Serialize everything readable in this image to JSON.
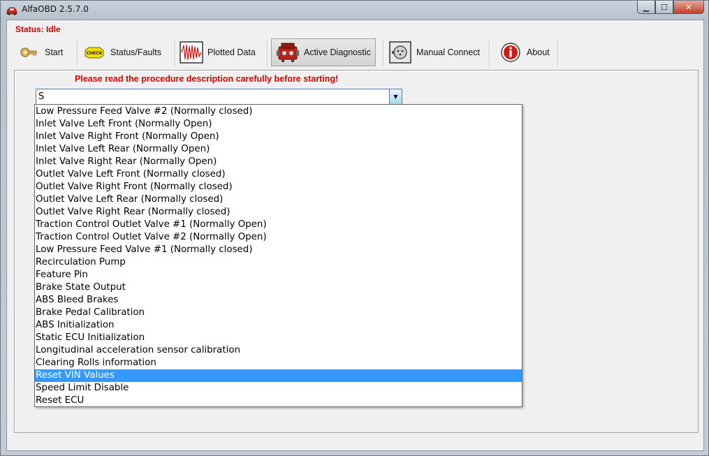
{
  "window": {
    "title": "AlfaOBD 2.5.7.0",
    "minimize_glyph": "▁",
    "maximize_glyph": "☐",
    "close_glyph": "✕"
  },
  "status": {
    "text": "Status: Idle"
  },
  "toolbar": {
    "start": "Start",
    "status_faults": "Status/Faults",
    "plotted_data": "Plotted Data",
    "active_diagnostic": "Active Diagnostic",
    "manual_connect": "Manual Connect",
    "about": "About",
    "check_badge": "CHECK"
  },
  "main": {
    "warning": "Please read the procedure description carefully before starting!",
    "combo_value": "S",
    "selected_index": 21,
    "items": [
      "Low Pressure Feed Valve #2 (Normally closed)",
      "Inlet Valve Left Front (Normally Open)",
      "Inlet Valve Right Front (Normally Open)",
      "Inlet Valve Left Rear (Normally Open)",
      "Inlet Valve Right Rear (Normally Open)",
      "Outlet Valve Left Front (Normally closed)",
      "Outlet Valve Right Front (Normally closed)",
      "Outlet Valve Left Rear (Normally closed)",
      "Outlet Valve Right Rear (Normally closed)",
      "Traction Control Outlet Valve #1 (Normally Open)",
      "Traction Control Outlet Valve #2 (Normally Open)",
      "Low Pressure Feed Valve #1 (Normally closed)",
      "Recirculation Pump",
      "Feature  Pin",
      "Brake State Output",
      "ABS Bleed Brakes",
      "Brake Pedal Calibration",
      "ABS Initialization",
      "Static ECU Initialization",
      "Longitudinal acceleration sensor calibration",
      "Clearing Rolls information",
      "Reset VIN Values",
      "Speed Limit Disable",
      "Reset ECU"
    ]
  }
}
